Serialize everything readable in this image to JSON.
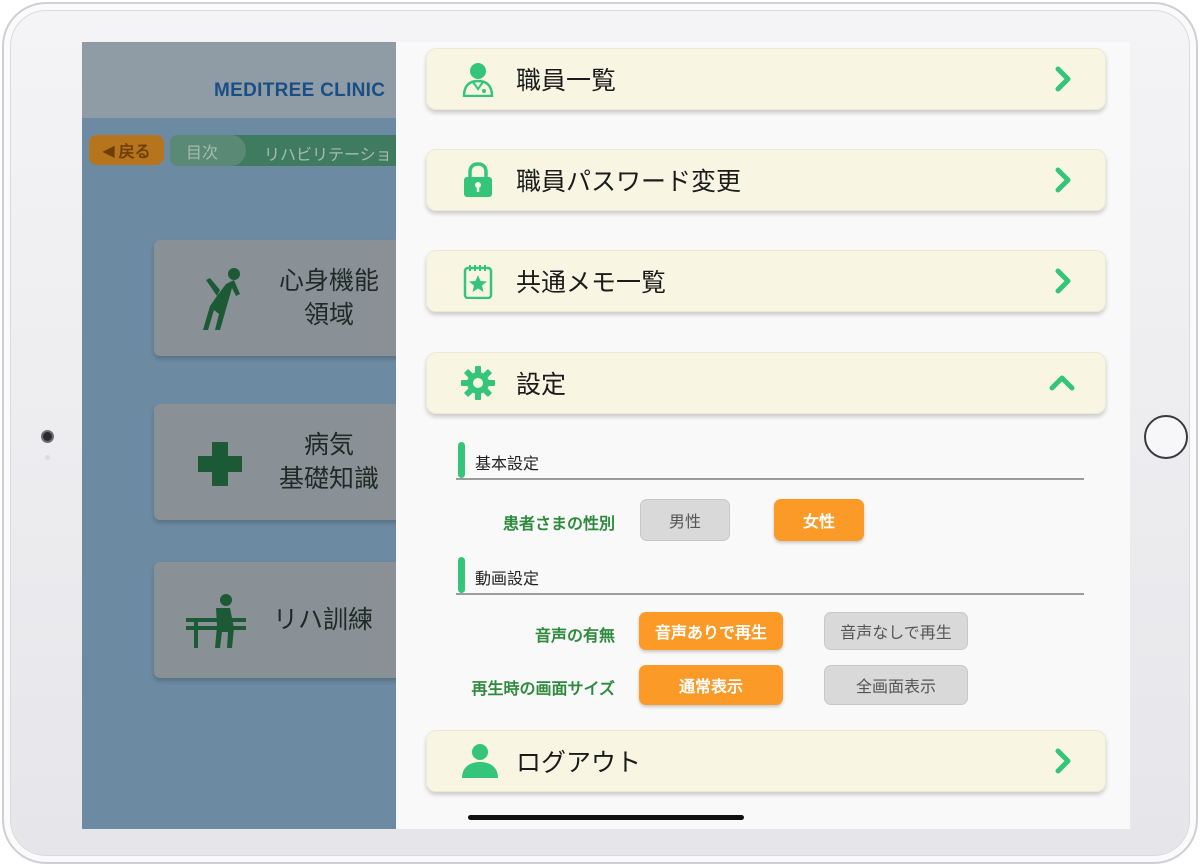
{
  "app": {
    "clinic_name": "MEDITREE CLINIC",
    "back_label": "戻る",
    "breadcrumb": [
      "目次",
      "リハビリテーショ"
    ],
    "menu_cards": [
      {
        "label": "心身機能\n領域",
        "icon": "stretching-person-icon"
      },
      {
        "label": "病気\n基礎知識",
        "icon": "medical-cross-icon"
      },
      {
        "label": "リハ訓練",
        "icon": "rehab-training-icon"
      }
    ]
  },
  "drawer": {
    "rows": [
      {
        "label": "職員一覧",
        "icon": "staff-doctor-icon",
        "indicator": "chevron-right-icon"
      },
      {
        "label": "職員パスワード変更",
        "icon": "lock-icon",
        "indicator": "chevron-right-icon"
      },
      {
        "label": "共通メモ一覧",
        "icon": "memo-star-icon",
        "indicator": "chevron-right-icon"
      },
      {
        "label": "設定",
        "icon": "gear-icon",
        "indicator": "chevron-up-icon"
      }
    ],
    "settings": {
      "basic": {
        "title": "基本設定",
        "gender_label": "患者さまの性別",
        "gender_options": [
          "男性",
          "女性"
        ],
        "gender_selected": "女性"
      },
      "video": {
        "title": "動画設定",
        "audio_label": "音声の有無",
        "audio_options": [
          "音声ありで再生",
          "音声なしで再生"
        ],
        "audio_selected": "音声ありで再生",
        "size_label": "再生時の画面サイズ",
        "size_options": [
          "通常表示",
          "全画面表示"
        ],
        "size_selected": "通常表示"
      }
    },
    "logout": {
      "label": "ログアウト",
      "icon": "user-icon",
      "indicator": "chevron-right-icon"
    }
  },
  "colors": {
    "accent_green": "#35c57a",
    "selected_orange": "#fb9a26",
    "row_background": "#f8f6e2",
    "label_green": "#2e8a3c"
  }
}
